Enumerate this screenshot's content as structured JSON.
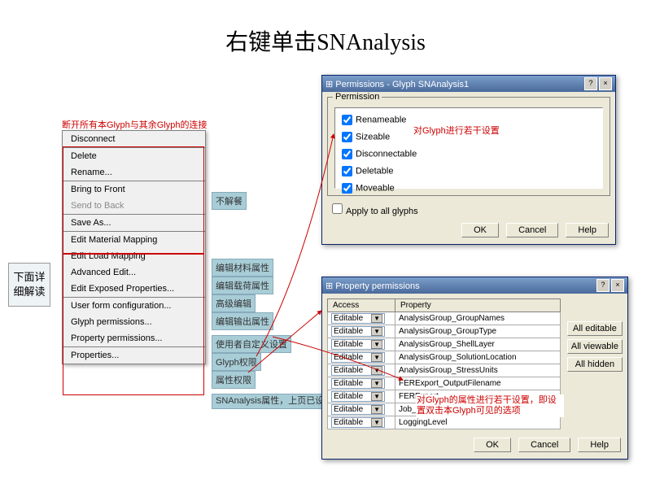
{
  "title": "右键单击SNAnalysis",
  "sideLabel": "下面详细解读",
  "notes": {
    "topRed": "断开所有本Glyph与其余Glyph的连接",
    "buKaiCan": "不解餐",
    "editMat": "编辑材料属性",
    "editLoad": "编辑载荷属性",
    "advEdit": "高级编辑",
    "editExp": "编辑输出属性",
    "userForm": "使用者自定义设置",
    "glyphPerm": "Glyph权限",
    "propPerm": "属性权限",
    "snProps": "SNAnalysis属性，上页已设置",
    "permNote": "对Glyph进行若干设置",
    "propNote": "对Glyph的属性进行若干设置，即设置双击本Glyph可见的选项"
  },
  "menu": {
    "disconnect": "Disconnect",
    "delete": "Delete",
    "rename": "Rename...",
    "btf": "Bring to Front",
    "stb": "Send to Back",
    "save": "Save As...",
    "editMat": "Edit Material Mapping",
    "editLoad": "Edit Load Mapping",
    "advEdit": "Advanced Edit...",
    "editExp": "Edit Exposed Properties...",
    "userForm": "User form configuration...",
    "glyphPerm": "Glyph permissions...",
    "propPerm": "Property permissions...",
    "props": "Properties..."
  },
  "dlg1": {
    "title": "Permissions - Glyph SNAnalysis1",
    "group": "Permission",
    "items": [
      "Renameable",
      "Sizeable",
      "Disconnectable",
      "Deletable",
      "Moveable"
    ],
    "apply": "Apply to all glyphs",
    "ok": "OK",
    "cancel": "Cancel",
    "help": "Help"
  },
  "dlg2": {
    "title": "Property permissions",
    "colAccess": "Access",
    "colProp": "Property",
    "access": "Editable",
    "rows": [
      "AnalysisGroup_GroupNames",
      "AnalysisGroup_GroupType",
      "AnalysisGroup_ShellLayer",
      "AnalysisGroup_SolutionLocation",
      "AnalysisGroup_StressUnits",
      "FERExport_OutputFilename",
      "FERExport",
      "Job_NumAnalysisThreads",
      "LoggingLevel"
    ],
    "allEdit": "All editable",
    "allView": "All viewable",
    "allHide": "All hidden",
    "ok": "OK",
    "cancel": "Cancel",
    "help": "Help"
  }
}
